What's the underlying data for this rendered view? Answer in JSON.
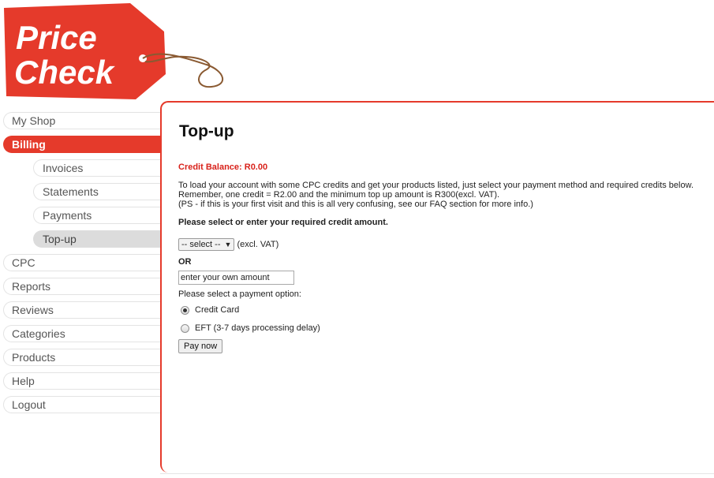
{
  "logo": {
    "line1": "Price",
    "line2": "Check",
    "color": "#e53a2b"
  },
  "sidebar": {
    "items": [
      {
        "label": "My Shop"
      },
      {
        "label": "Billing",
        "active": true
      },
      {
        "label": "Invoices"
      },
      {
        "label": "Statements"
      },
      {
        "label": "Payments"
      },
      {
        "label": "Top-up",
        "current": true
      },
      {
        "label": "CPC"
      },
      {
        "label": "Reports"
      },
      {
        "label": "Reviews"
      },
      {
        "label": "Categories"
      },
      {
        "label": "Products"
      },
      {
        "label": "Help"
      },
      {
        "label": "Logout"
      }
    ]
  },
  "main": {
    "title": "Top-up",
    "balance": "Credit Balance: R0.00",
    "info_line1": "To load your account with some CPC credits and get your products listed, just select your payment method and required credits below.",
    "info_line2": "Remember, one credit = R2.00 and the minimum top up amount is R300(excl. VAT).",
    "info_line3": "(PS - if this is your first visit and this is all very confusing, see our FAQ section for more info.)",
    "prompt": "Please select or enter your required credit amount.",
    "select_value": "-- select --",
    "select_suffix": "(excl. VAT)",
    "or_label": "OR",
    "amount_placeholder": "enter your own amount",
    "payment_label": "Please select a payment option:",
    "options": [
      {
        "label": "Credit Card",
        "checked": true
      },
      {
        "label": "EFT (3-7 days processing delay)",
        "checked": false
      }
    ],
    "pay_button": "Pay now"
  },
  "colors": {
    "accent": "#e53a2b",
    "balance_text": "#d8221b"
  }
}
